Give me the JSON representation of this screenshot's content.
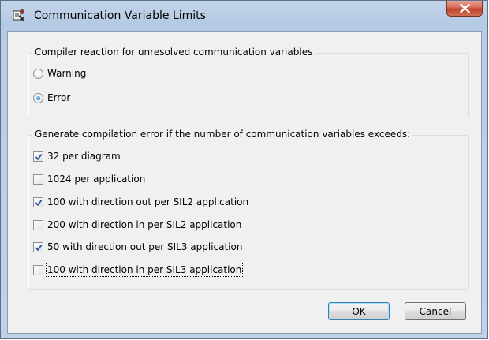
{
  "window": {
    "title": "Communication Variable Limits"
  },
  "reaction_group": {
    "legend": "Compiler reaction for unresolved communication variables",
    "options": [
      {
        "label": "Warning",
        "selected": false
      },
      {
        "label": "Error",
        "selected": true
      }
    ]
  },
  "limits_group": {
    "legend": "Generate compilation error if the number of communication variables exceeds:",
    "options": [
      {
        "label": "32 per diagram",
        "checked": true
      },
      {
        "label": "1024 per application",
        "checked": false
      },
      {
        "label": "100 with direction out per SIL2 application",
        "checked": true
      },
      {
        "label": "200 with direction in per SIL2 application",
        "checked": false
      },
      {
        "label": "50 with direction out per SIL3 application",
        "checked": true
      },
      {
        "label": "100 with direction in per SIL3 application",
        "checked": false,
        "focused": true
      }
    ]
  },
  "buttons": {
    "ok": "OK",
    "cancel": "Cancel"
  },
  "icons": {
    "app": "communication-app-icon",
    "close": "close-icon",
    "checkmark": "checkmark-icon"
  },
  "colors": {
    "checkmark": "#2a54a8",
    "radio_dot": "#2a7fc9",
    "close_button": "#c1412a"
  }
}
